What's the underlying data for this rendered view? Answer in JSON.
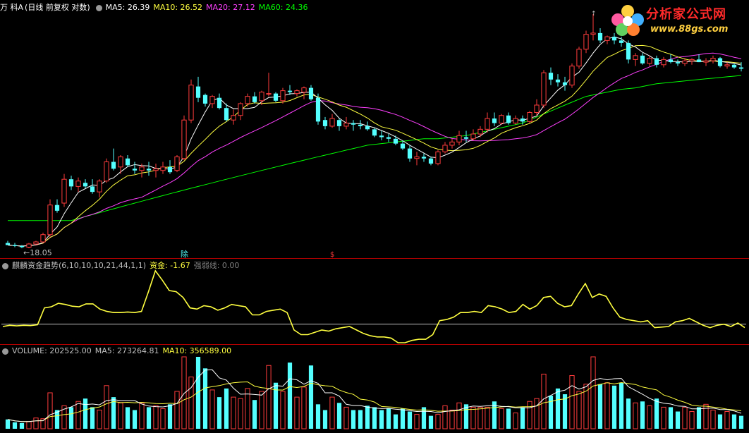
{
  "title": "万 科A",
  "mode": "(日线 前复权 对数)",
  "ma_labels": [
    {
      "text": "MA5: 26.39",
      "color": "#ffffff"
    },
    {
      "text": "MA10: 26.52",
      "color": "#ffff40"
    },
    {
      "text": "MA20: 27.12",
      "color": "#ff40ff"
    },
    {
      "text": "MA60: 24.36",
      "color": "#00ff00"
    }
  ],
  "low_annotation": "←18.05",
  "high_marker": "↑",
  "event_markers": [
    "除",
    "$"
  ],
  "logo": {
    "text": "分析家公式网",
    "url_text": "www.88gs.com"
  },
  "indicator": {
    "name": "麒麟资金趋势(6,10,10,10,21,44,1,1)",
    "value_label": "资金: -1.67",
    "strong_label": "强弱线: 0.00",
    "series": [
      -0.2,
      -0.1,
      -0.15,
      -0.1,
      -0.12,
      -0.05,
      1.4,
      1.5,
      1.8,
      1.7,
      1.55,
      1.5,
      1.75,
      1.75,
      1.3,
      1.1,
      1.0,
      1.0,
      1.05,
      1.0,
      1.1,
      2.8,
      4.6,
      3.8,
      2.9,
      2.8,
      2.3,
      1.4,
      1.3,
      1.6,
      1.5,
      1.2,
      1.4,
      1.7,
      1.6,
      1.5,
      0.8,
      0.8,
      1.1,
      1.2,
      1.3,
      1.0,
      -0.5,
      -0.9,
      -0.9,
      -0.7,
      -0.5,
      -0.6,
      -0.4,
      -0.3,
      -0.2,
      -0.5,
      -0.8,
      -1.0,
      -1.1,
      -1.1,
      -1.2,
      -1.6,
      -1.6,
      -1.4,
      -1.3,
      -1.3,
      -0.9,
      0.3,
      0.4,
      0.6,
      1.0,
      1.0,
      1.1,
      1.0,
      1.6,
      1.5,
      1.3,
      1.0,
      1.1,
      1.7,
      1.3,
      1.6,
      2.3,
      2.4,
      1.8,
      1.5,
      1.6,
      2.6,
      3.5,
      2.3,
      2.6,
      2.4,
      1.4,
      0.6,
      0.4,
      0.3,
      0.2,
      0.3,
      -0.3,
      -0.25,
      -0.2,
      0.2,
      0.3,
      0.5,
      0.2,
      -0.1,
      -0.3,
      -0.1,
      0.0,
      -0.2,
      0.1,
      -0.3
    ]
  },
  "volume_header": {
    "volume_label": "VOLUME: 202525.00",
    "ma5_label": "MA5: 273264.81",
    "ma10_label": "MA10: 356589.00"
  },
  "colors": {
    "up": "#ff3c3c",
    "down": "#54ffff",
    "ma5": "#ffffff",
    "ma10": "#ffff40",
    "ma20": "#ff40ff",
    "ma60": "#00ff00",
    "indicator": "#ffff40",
    "strong": "#c0c0c0",
    "separator": "#b00000"
  },
  "chart_data": {
    "type": "candlestick",
    "symbol": "万 科A",
    "price_low_marked": 18.05,
    "price_high_approx": 33.0,
    "ohlc": [
      [
        18.3,
        18.4,
        18.2,
        18.2
      ],
      [
        18.2,
        18.3,
        18.1,
        18.15
      ],
      [
        18.15,
        18.2,
        18.05,
        18.1
      ],
      [
        18.1,
        18.3,
        18.05,
        18.25
      ],
      [
        18.25,
        18.4,
        18.2,
        18.35
      ],
      [
        18.35,
        18.8,
        18.3,
        18.7
      ],
      [
        18.7,
        20.5,
        18.6,
        20.2
      ],
      [
        20.2,
        20.5,
        19.8,
        19.9
      ],
      [
        20.3,
        21.9,
        20.1,
        21.6
      ],
      [
        21.6,
        21.8,
        21.0,
        21.2
      ],
      [
        21.2,
        21.7,
        20.9,
        21.5
      ],
      [
        21.4,
        21.6,
        21.1,
        21.2
      ],
      [
        21.2,
        21.6,
        20.8,
        20.9
      ],
      [
        20.9,
        21.6,
        20.6,
        21.5
      ],
      [
        21.5,
        22.8,
        21.4,
        22.6
      ],
      [
        22.6,
        23.4,
        22.1,
        22.2
      ],
      [
        22.3,
        23.0,
        21.9,
        22.9
      ],
      [
        22.8,
        23.0,
        22.3,
        22.4
      ],
      [
        22.2,
        22.6,
        21.9,
        22.1
      ],
      [
        22.1,
        22.5,
        21.7,
        22.3
      ],
      [
        22.2,
        22.6,
        21.8,
        22.1
      ],
      [
        22.1,
        22.5,
        21.7,
        22.2
      ],
      [
        22.1,
        22.6,
        21.9,
        22.3
      ],
      [
        22.3,
        22.7,
        21.9,
        22.0
      ],
      [
        22.1,
        23.0,
        22.0,
        22.9
      ],
      [
        22.8,
        25.5,
        22.7,
        25.2
      ],
      [
        25.2,
        28.0,
        25.0,
        27.6
      ],
      [
        27.5,
        28.2,
        26.4,
        26.7
      ],
      [
        26.9,
        27.0,
        26.1,
        26.3
      ],
      [
        26.3,
        26.9,
        26.0,
        26.8
      ],
      [
        26.7,
        27.0,
        25.9,
        26.0
      ],
      [
        26.0,
        26.3,
        25.1,
        25.2
      ],
      [
        25.2,
        25.9,
        24.9,
        25.5
      ],
      [
        25.5,
        26.4,
        25.2,
        26.3
      ],
      [
        26.3,
        27.0,
        26.1,
        26.8
      ],
      [
        26.8,
        27.1,
        26.3,
        26.4
      ],
      [
        26.5,
        27.2,
        26.2,
        27.1
      ],
      [
        27.0,
        28.5,
        26.8,
        27.0
      ],
      [
        27.0,
        27.1,
        26.4,
        26.5
      ],
      [
        26.5,
        27.4,
        26.3,
        27.2
      ],
      [
        27.2,
        27.6,
        26.9,
        27.1
      ],
      [
        27.0,
        27.3,
        26.8,
        27.2
      ],
      [
        27.1,
        27.5,
        26.6,
        27.4
      ],
      [
        27.4,
        27.6,
        26.5,
        26.6
      ],
      [
        26.7,
        27.0,
        24.9,
        25.1
      ],
      [
        25.2,
        25.4,
        24.6,
        24.8
      ],
      [
        24.8,
        25.6,
        24.7,
        25.3
      ],
      [
        25.2,
        25.3,
        24.5,
        24.8
      ],
      [
        24.8,
        25.4,
        24.6,
        25.0
      ],
      [
        25.0,
        25.2,
        24.5,
        24.9
      ],
      [
        24.9,
        25.2,
        24.6,
        24.8
      ],
      [
        24.8,
        25.1,
        24.5,
        24.6
      ],
      [
        24.6,
        24.7,
        24.1,
        24.2
      ],
      [
        24.2,
        24.5,
        23.9,
        24.1
      ],
      [
        24.1,
        24.3,
        23.8,
        24.0
      ],
      [
        24.0,
        24.2,
        23.6,
        23.7
      ],
      [
        23.7,
        23.9,
        23.3,
        23.4
      ],
      [
        23.4,
        23.6,
        22.6,
        22.8
      ],
      [
        22.8,
        23.2,
        22.4,
        22.9
      ],
      [
        22.9,
        23.1,
        22.6,
        22.8
      ],
      [
        22.8,
        22.9,
        22.4,
        22.5
      ],
      [
        22.5,
        23.3,
        22.4,
        23.2
      ],
      [
        23.2,
        23.8,
        23.1,
        23.6
      ],
      [
        23.6,
        24.0,
        23.4,
        23.8
      ],
      [
        23.8,
        24.5,
        23.6,
        24.2
      ],
      [
        24.1,
        24.5,
        23.8,
        24.0
      ],
      [
        24.0,
        24.6,
        23.9,
        24.3
      ],
      [
        24.3,
        24.8,
        24.1,
        24.6
      ],
      [
        24.6,
        25.7,
        24.4,
        25.3
      ],
      [
        25.3,
        25.7,
        24.8,
        25.0
      ],
      [
        25.0,
        25.6,
        24.9,
        25.5
      ],
      [
        25.5,
        25.7,
        24.9,
        25.0
      ],
      [
        25.0,
        25.5,
        24.9,
        25.3
      ],
      [
        25.3,
        25.5,
        24.9,
        25.1
      ],
      [
        25.1,
        25.8,
        25.0,
        25.7
      ],
      [
        25.7,
        26.6,
        25.5,
        26.2
      ],
      [
        26.2,
        28.7,
        26.0,
        28.5
      ],
      [
        28.5,
        28.9,
        27.6,
        28.0
      ],
      [
        28.0,
        28.4,
        27.5,
        27.8
      ],
      [
        27.8,
        28.2,
        27.2,
        27.6
      ],
      [
        27.6,
        29.2,
        27.4,
        29.0
      ],
      [
        29.0,
        30.5,
        28.8,
        30.3
      ],
      [
        30.3,
        31.8,
        30.0,
        31.5
      ],
      [
        31.5,
        33.2,
        31.0,
        31.6
      ],
      [
        31.6,
        32.0,
        30.8,
        31.0
      ],
      [
        31.0,
        31.4,
        30.7,
        31.3
      ],
      [
        31.3,
        31.6,
        30.7,
        31.0
      ],
      [
        31.0,
        31.3,
        30.5,
        30.8
      ],
      [
        30.8,
        31.0,
        29.2,
        29.5
      ],
      [
        29.5,
        30.0,
        29.0,
        29.8
      ],
      [
        29.8,
        30.0,
        29.1,
        29.2
      ],
      [
        29.2,
        29.8,
        29.0,
        29.6
      ],
      [
        29.6,
        29.8,
        28.9,
        29.1
      ],
      [
        29.1,
        29.7,
        28.9,
        29.5
      ],
      [
        29.5,
        29.9,
        29.2,
        29.3
      ],
      [
        29.3,
        29.5,
        29.0,
        29.2
      ],
      [
        29.2,
        29.6,
        29.0,
        29.4
      ],
      [
        29.4,
        29.6,
        29.1,
        29.5
      ],
      [
        29.5,
        29.9,
        29.3,
        29.3
      ],
      [
        29.3,
        29.6,
        29.0,
        29.4
      ],
      [
        29.4,
        29.8,
        29.2,
        29.6
      ],
      [
        29.6,
        29.7,
        28.9,
        29.0
      ],
      [
        29.0,
        29.3,
        28.8,
        29.1
      ],
      [
        29.1,
        29.2,
        28.8,
        28.9
      ],
      [
        28.9,
        29.3,
        28.6,
        28.8
      ]
    ],
    "ma60": [
      19.4,
      19.4,
      19.4,
      19.4,
      19.4,
      19.4,
      19.4,
      19.4,
      19.4,
      19.4,
      19.5,
      19.6,
      19.7,
      19.8,
      19.9,
      20.0,
      20.1,
      20.2,
      20.3,
      20.4,
      20.5,
      20.6,
      20.7,
      20.8,
      20.9,
      21.0,
      21.1,
      21.2,
      21.3,
      21.4,
      21.5,
      21.6,
      21.7,
      21.8,
      21.9,
      22.0,
      22.1,
      22.2,
      22.3,
      22.4,
      22.5,
      22.6,
      22.7,
      22.8,
      22.9,
      23.0,
      23.1,
      23.2,
      23.3,
      23.4,
      23.5,
      23.6,
      23.65,
      23.7,
      23.75,
      23.8,
      23.85,
      23.9,
      23.95,
      24.0,
      24.0,
      24.0,
      24.05,
      24.1,
      24.15,
      24.2,
      24.3,
      24.4,
      24.5,
      24.6,
      24.7,
      24.8,
      24.9,
      25.0,
      25.2,
      25.4,
      25.6,
      25.8,
      26.0,
      26.2,
      26.4,
      26.6,
      26.8,
      26.9,
      27.0,
      27.1,
      27.2,
      27.3,
      27.35,
      27.4,
      27.5,
      27.6,
      27.7,
      27.75,
      27.8,
      27.85,
      27.9,
      27.95,
      28.0,
      28.05,
      28.1,
      28.15,
      28.2,
      28.25,
      28.3
    ],
    "volume": [
      130,
      90,
      80,
      100,
      150,
      140,
      500,
      260,
      320,
      300,
      380,
      420,
      300,
      260,
      600,
      440,
      360,
      300,
      260,
      360,
      300,
      320,
      280,
      340,
      520,
      1000,
      720,
      1000,
      840,
      540,
      440,
      560,
      440,
      420,
      560,
      400,
      520,
      880,
      640,
      520,
      920,
      440,
      580,
      880,
      340,
      260,
      440,
      360,
      300,
      260,
      260,
      320,
      300,
      260,
      280,
      200,
      280,
      240,
      200,
      300,
      180,
      200,
      320,
      260,
      360,
      340,
      300,
      300,
      300,
      380,
      280,
      280,
      220,
      300,
      380,
      420,
      760,
      460,
      560,
      480,
      740,
      520,
      620,
      1000,
      620,
      640,
      600,
      640,
      420,
      360,
      380,
      320,
      420,
      300,
      300,
      240,
      300,
      240,
      300,
      340,
      260,
      200,
      240,
      200,
      180
    ],
    "volume_ma5_last": 273264.81,
    "volume_ma10_last": 356589.0
  }
}
